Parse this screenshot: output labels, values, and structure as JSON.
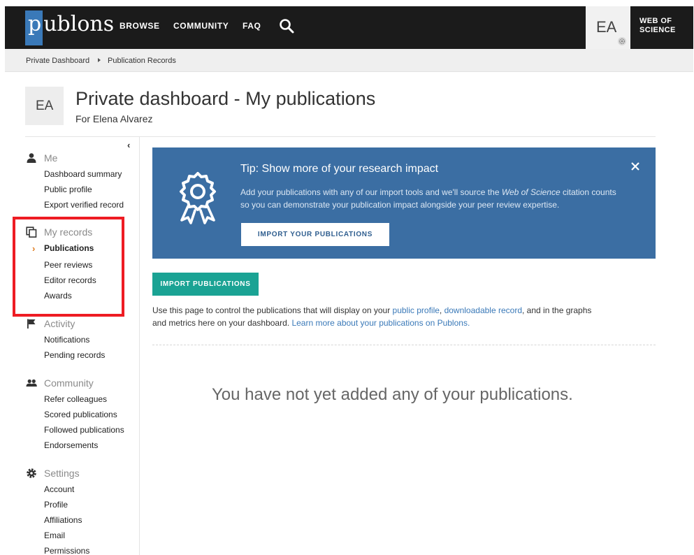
{
  "nav": {
    "logo_first": "p",
    "logo_rest": "ublons",
    "links": [
      "BROWSE",
      "COMMUNITY",
      "FAQ"
    ],
    "avatar_initials": "EA",
    "wos_line1": "WEB OF",
    "wos_line2": "SCIENCE"
  },
  "breadcrumb": {
    "items": [
      "Private Dashboard",
      "Publication Records"
    ]
  },
  "header": {
    "avatar_initials": "EA",
    "title": "Private dashboard - My publications",
    "subtitle": "For Elena Alvarez"
  },
  "sidebar": {
    "collapse_glyph": "‹",
    "sections": [
      {
        "title": "Me",
        "icon": "user-icon",
        "items": [
          "Dashboard summary",
          "Public profile",
          "Export verified record"
        ]
      },
      {
        "title": "My records",
        "icon": "copy-icon",
        "items": [
          "Publications",
          "Peer reviews",
          "Editor records",
          "Awards"
        ]
      },
      {
        "title": "Activity",
        "icon": "flag-icon",
        "items": [
          "Notifications",
          "Pending records"
        ]
      },
      {
        "title": "Community",
        "icon": "users-icon",
        "items": [
          "Refer colleagues",
          "Scored publications",
          "Followed publications",
          "Endorsements"
        ]
      },
      {
        "title": "Settings",
        "icon": "gear-icon",
        "items": [
          "Account",
          "Profile",
          "Affiliations",
          "Email",
          "Permissions"
        ]
      }
    ],
    "active_item": "Publications",
    "highlight_color": "#ee1c23"
  },
  "tip": {
    "title": "Tip: Show more of your research impact",
    "body_pre": "Add your publications with any of our import tools and we'll source the ",
    "body_em": "Web of Science",
    "body_post": " citation counts so you can demonstrate your publication impact alongside your peer review expertise.",
    "button_label": "IMPORT YOUR PUBLICATIONS",
    "bg_color": "#3b6ea3"
  },
  "main": {
    "import_button": "IMPORT PUBLICATIONS",
    "import_color": "#1aa394",
    "info_1": "Use this page to control the publications that will display on your ",
    "link_public_profile": "public profile",
    "info_2": ", ",
    "link_downloadable": "downloadable record",
    "info_3": ", and in the graphs and metrics here on your dashboard. ",
    "link_learn": "Learn more about your publications on Publons.",
    "empty_message": "You have not yet added any of your publications."
  }
}
